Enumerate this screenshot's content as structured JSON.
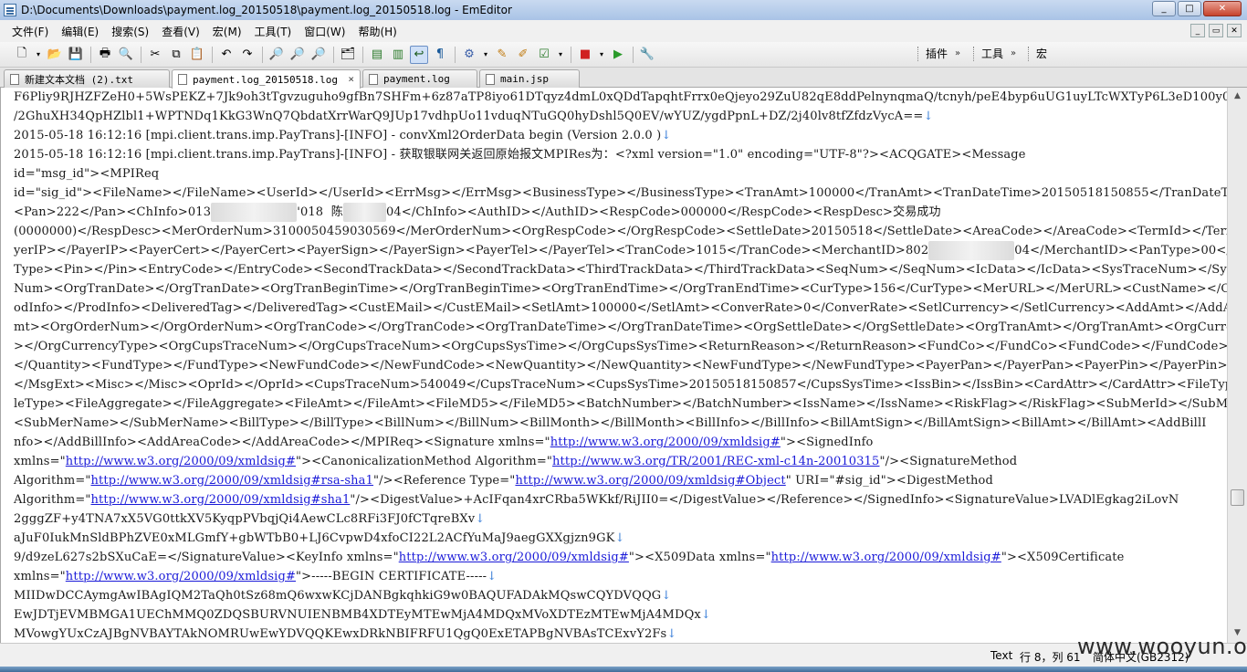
{
  "window": {
    "title": "D:\\Documents\\Downloads\\payment.log_20150518\\payment.log_20150518.log - EmEditor",
    "minimize": "_",
    "maximize": "□",
    "close": "✕"
  },
  "menu": {
    "items": [
      "文件(F)",
      "编辑(E)",
      "搜索(S)",
      "查看(V)",
      "宏(M)",
      "工具(T)",
      "窗口(W)",
      "帮助(H)"
    ]
  },
  "toolbar": {
    "plugins_label": "插件",
    "tools_label": "工具",
    "macros_label": "宏",
    "more_chevron": "»"
  },
  "tabs": [
    {
      "label": "新建文本文档 (2).txt",
      "active": false
    },
    {
      "label": "payment.log_20150518.log",
      "active": true,
      "close": "×"
    },
    {
      "label": "payment.log",
      "active": false
    },
    {
      "label": "main.jsp",
      "active": false
    }
  ],
  "editor": {
    "eol_marker": "↓",
    "lines": [
      "F6Pliy9RJHZFZeH0+5WsPEKZ+7Jk9oh3tTgvzuguho9gfBn7SHFm+6z87aTP8iyo61DTqyz4dmL0xQDdTapqhtFrrx0eQjeyo29ZuU82qE8ddPelnynqmaQ/tcnyh/peE4byp6uUG1uyLTcWXTyP6L3eD100y0ePobzz",
      "/2GhuXH34QpHZlbl1+WPTNDq1KkG3WnQ7QbdatXrrWarQ9JUp17vdhpUo11vduqNTuGQ0hyDshl5Q0EV/wYUZ/ygdPpnL+DZ/2j40lv8tfZfdzVycA==",
      "2015-05-18 16:12:16 [mpi.client.trans.imp.PayTrans]-[INFO] - convXml2OrderData begin (Version 2.0.0 )",
      "2015-05-18 16:12:16 [mpi.client.trans.imp.PayTrans]-[INFO] - 获取银联网关返回原始报文MPIRes为：<?xml version=\"1.0\" encoding=\"UTF-8\"?><ACQGATE><Message",
      "id=\"msg_id\"><MPIReq",
      "id=\"sig_id\"><FileName></FileName><UserId></UserId><ErrMsg></ErrMsg><BusinessType></BusinessType><TranAmt>100000</TranAmt><TranDateTime>20150518150855</TranDateTime>",
      "<Pan>222</Pan><ChInfo>013",
      "(0000000)</RespDesc><MerOrderNum>3100050459030569</MerOrderNum><OrgRespCode></OrgRespCode><SettleDate>20150518</SettleDate><AreaCode></AreaCode><TermId></TermId><Pa",
      "yerIP></PayerIP><PayerCert></PayerCert><PayerSign></PayerSign><PayerTel></PayerTel><TranCode>1015</TranCode><MerchantID>802",
      "Type><Pin></Pin><EntryCode></EntryCode><SecondTrackData></SecondTrackData><ThirdTrackData></ThirdTrackData><SeqNum></SeqNum><IcData></IcData><SysTraceNum></SysTrace",
      "Num><OrgTranDate></OrgTranDate><OrgTranBeginTime></OrgTranBeginTime><OrgTranEndTime></OrgTranEndTime><CurType>156</CurType><MerURL></MerURL><CustName></CustName><Pr",
      "odInfo></ProdInfo><DeliveredTag></DeliveredTag><CustEMail></CustEMail><SetlAmt>100000</SetlAmt><ConverRate>0</ConverRate><SetlCurrency></SetlCurrency><AddAmt></AddA",
      "mt><OrgOrderNum></OrgOrderNum><OrgTranCode></OrgTranCode><OrgTranDateTime></OrgTranDateTime><OrgSettleDate></OrgSettleDate><OrgTranAmt></OrgTranAmt><OrgCurrencyType",
      "></OrgCurrencyType><OrgCupsTraceNum></OrgCupsTraceNum><OrgCupsSysTime></OrgCupsSysTime><ReturnReason></ReturnReason><FundCo></FundCo><FundCode></FundCode><Quantity>",
      "</Quantity><FundType></FundType><NewFundCode></NewFundCode><NewQuantity></NewQuantity><NewFundType></NewFundType><PayerPan></PayerPan><PayerPin></PayerPin><MsgExt>",
      "</MsgExt><Misc></Misc><OprId></OprId><CupsTraceNum>540049</CupsTraceNum><CupsSysTime>20150518150857</CupsSysTime><IssBin></IssBin><CardAttr></CardAttr><FileType></Fi",
      "leType><FileAggregate></FileAggregate><FileAmt></FileAmt><FileMD5></FileMD5><BatchNumber></BatchNumber><IssName></IssName><RiskFlag></RiskFlag><SubMerId></SubMerId>",
      "<SubMerName></SubMerName><BillType></BillType><BillNum></BillNum><BillMonth></BillMonth><BillInfo></BillInfo><BillAmtSign></BillAmtSign><BillAmt></BillAmt><AddBillI",
      "nfo></AddBillInfo><AddAreaCode></AddAreaCode></MPIReq><Signature xmlns=\"",
      "xmlns=\"",
      "Algorithm=\"",
      "Algorithm=\"",
      "2gggZF+y4TNA7xX5VG0ttkXV5KyqpPVbqjQi4AewCLc8RFi3FJ0fCTqreBXv",
      "aJuF0IukMnSldBPhZVE0xMLGmfY+gbWTbB0+LJ6CvpwD4xfoCI22L2ACfYuMaJ9aegGXXgjzn9GK",
      "9/d9zeL627s2bSXuCaE=</SignatureValue><KeyInfo xmlns=\"",
      "xmlns=\"",
      "MIIDwDCCAymgAwIBAgIQM2TaQh0tSz68mQ6wxwKCjDANBgkqhkiG9w0BAQUFADAkMQswCQYDVQQG",
      "EwJDTjEVMBMGA1UEChMMQ0ZDQSBURVNUIENBMB4XDTEyMTEwMjA4MDQxMVoXDTEzMTEwMjA4MDQx",
      "MVowgYUxCzAJBgNVBAYTAkNOMRUwEwYDVQQKEwxDRkNBIFRFU1QgQ0ExETAPBgNVBAsTCExvY2Fs"
    ],
    "frag": {
      "l6_mid": "'018  ",
      "l6_name": "陈",
      "l6_tail": "04</ChInfo><AuthID></AuthID><RespCode>000000</RespCode><RespDesc>交易成功",
      "l8_tail": "04</MerchantID><PanType>00</Pan",
      "l18_tail": "\"><SignedInfo",
      "l19_mid": "\"><CanonicalizationMethod Algorithm=\"",
      "l19_tail": "\"/><SignatureMethod",
      "l20_mid": "\"/><Reference Type=\"",
      "l20_tail": "\" URI=\"#sig_id\"><DigestMethod",
      "l21_tail": "\"/><DigestValue>+AcIFqan4xrCRba5WKkf/RiJII0=</DigestValue></Reference></SignedInfo><SignatureValue>LVADlEgkag2iLovN",
      "l24_mid": "\"><X509Data xmlns=\"",
      "l24_tail": "\"><X509Certificate",
      "l25_tail": "\">-----BEGIN CERTIFICATE-----",
      "xmldsig": "http://www.w3.org/2000/09/xmldsig#",
      "c14n": "http://www.w3.org/TR/2001/REC-xml-c14n-20010315",
      "rsa_sha1": "http://www.w3.org/2000/09/xmldsig#rsa-sha1",
      "object": "http://www.w3.org/2000/09/xmldsig#Object",
      "sha1": "http://www.w3.org/2000/09/xmldsig#sha1"
    }
  },
  "status": {
    "mode": "Text",
    "position": "行 8，列 61",
    "encoding": "简体中文(GB2312)"
  },
  "watermark": "www.wooyun.org"
}
